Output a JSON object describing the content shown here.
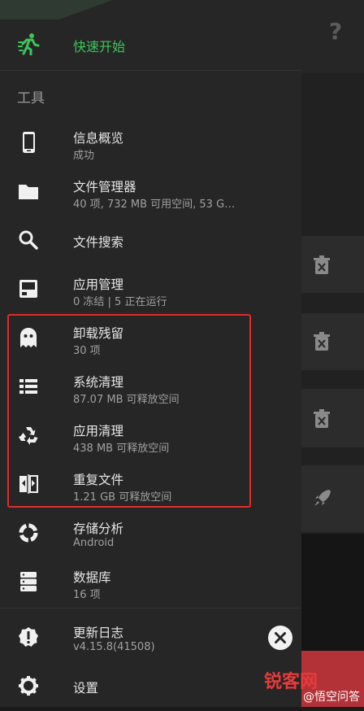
{
  "quick_start": {
    "label": "快速开始"
  },
  "section": {
    "title": "工具"
  },
  "items": [
    {
      "title": "信息概览",
      "sub": "成功"
    },
    {
      "title": "文件管理器",
      "sub": "40 项, 732 MB 可用空间, 53 G…"
    },
    {
      "title": "文件搜索",
      "sub": ""
    },
    {
      "title": "应用管理",
      "sub": "0 冻结 | 5 正在运行"
    },
    {
      "title": "卸载残留",
      "sub": "30 项"
    },
    {
      "title": "系统清理",
      "sub": "87.07 MB 可释放空间"
    },
    {
      "title": "应用清理",
      "sub": "438 MB 可释放空间"
    },
    {
      "title": "重复文件",
      "sub": "1.21 GB 可释放空间"
    },
    {
      "title": "存储分析",
      "sub": "Android"
    },
    {
      "title": "数据库",
      "sub": "16 项"
    },
    {
      "title": "更新日志",
      "sub": "v4.15.8(41508)"
    },
    {
      "title": "设置",
      "sub": ""
    }
  ],
  "background": {
    "help_glyph": "?"
  },
  "watermark": {
    "brand": "锐客网",
    "sub": "@悟空问答"
  },
  "colors": {
    "accent_green": "#3ec45c",
    "highlight_red": "#e22b2b",
    "drawer_bg": "#262626"
  }
}
